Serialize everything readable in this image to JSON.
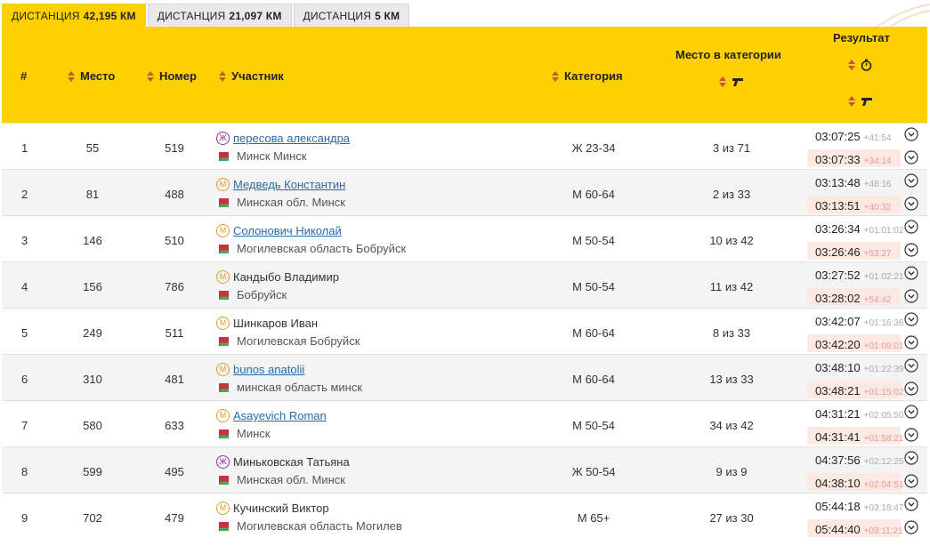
{
  "tabs": [
    {
      "prefix": "ДИСТАНЦИЯ",
      "value": "42,195 КМ",
      "active": true
    },
    {
      "prefix": "ДИСТАНЦИЯ",
      "value": "21,097 КМ",
      "active": false
    },
    {
      "prefix": "ДИСТАНЦИЯ",
      "value": "5 КМ",
      "active": false
    }
  ],
  "columns": {
    "num": "#",
    "place": "Место",
    "bib": "Номер",
    "participant": "Участник",
    "category": "Категория",
    "category_place": "Место в категории",
    "result": "Результат"
  },
  "icons": {
    "sort": "sort-arrows-icon",
    "stopwatch": "stopwatch-icon",
    "gun": "starter-pistol-icon",
    "flag": "belarus-flag-icon",
    "expand": "chevron-down-circle-icon"
  },
  "colors": {
    "header": "#ffd000",
    "sort_arrow": "#c0593d",
    "male": "#e39a2a",
    "female": "#9a2a9a",
    "link": "#2a6aa6",
    "chip": "#fbe9e2"
  },
  "rows": [
    {
      "n": "1",
      "place": "55",
      "bib": "519",
      "gender": "Ж",
      "g": "f",
      "name": "пересова александра",
      "link": true,
      "city": "Минск Минск",
      "cat": "Ж 23-34",
      "catplace": "3 из 71",
      "chip": "03:07:25",
      "chip_gap": "+41:54",
      "gun": "03:07:33",
      "gun_gap": "+34:14"
    },
    {
      "n": "2",
      "place": "81",
      "bib": "488",
      "gender": "М",
      "g": "m",
      "name": "Медведь Константин",
      "link": true,
      "city": "Минская обл. Минск",
      "cat": "М 60-64",
      "catplace": "2 из 33",
      "chip": "03:13:48",
      "chip_gap": "+48:16",
      "gun": "03:13:51",
      "gun_gap": "+40:32"
    },
    {
      "n": "3",
      "place": "146",
      "bib": "510",
      "gender": "М",
      "g": "m",
      "name": "Солонович Николай",
      "link": true,
      "city": "Могилевская область Бобруйск",
      "cat": "М 50-54",
      "catplace": "10 из 42",
      "chip": "03:26:34",
      "chip_gap": "+01:01:02",
      "gun": "03:26:46",
      "gun_gap": "+53:27"
    },
    {
      "n": "4",
      "place": "156",
      "bib": "786",
      "gender": "М",
      "g": "m",
      "name": "Кандыбо Владимир",
      "link": false,
      "city": "Бобруйск",
      "cat": "М 50-54",
      "catplace": "11 из 42",
      "chip": "03:27:52",
      "chip_gap": "+01:02:21",
      "gun": "03:28:02",
      "gun_gap": "+54:42"
    },
    {
      "n": "5",
      "place": "249",
      "bib": "511",
      "gender": "М",
      "g": "m",
      "name": "Шинкаров Иван",
      "link": false,
      "city": "Могилевская Бобруйск",
      "cat": "М 60-64",
      "catplace": "8 из 33",
      "chip": "03:42:07",
      "chip_gap": "+01:16:36",
      "gun": "03:42:20",
      "gun_gap": "+01:09:01"
    },
    {
      "n": "6",
      "place": "310",
      "bib": "481",
      "gender": "М",
      "g": "m",
      "name": "bunos anatolii",
      "link": true,
      "city": "минская область минск",
      "cat": "М 60-64",
      "catplace": "13 из 33",
      "chip": "03:48:10",
      "chip_gap": "+01:22:39",
      "gun": "03:48:21",
      "gun_gap": "+01:15:02"
    },
    {
      "n": "7",
      "place": "580",
      "bib": "633",
      "gender": "М",
      "g": "m",
      "name": "Asayevich Roman",
      "link": true,
      "city": "Минск",
      "cat": "М 50-54",
      "catplace": "34 из 42",
      "chip": "04:31:21",
      "chip_gap": "+02:05:50",
      "gun": "04:31:41",
      "gun_gap": "+01:58:21"
    },
    {
      "n": "8",
      "place": "599",
      "bib": "495",
      "gender": "Ж",
      "g": "f",
      "name": "Миньковская Татьяна",
      "link": false,
      "city": "Минская обл. Минск",
      "cat": "Ж 50-54",
      "catplace": "9 из 9",
      "chip": "04:37:56",
      "chip_gap": "+02:12:25",
      "gun": "04:38:10",
      "gun_gap": "+02:04:51"
    },
    {
      "n": "9",
      "place": "702",
      "bib": "479",
      "gender": "М",
      "g": "m",
      "name": "Кучинский Виктор",
      "link": false,
      "city": "Могилевская область Могилев",
      "cat": "М 65+",
      "catplace": "27 из 30",
      "chip": "05:44:18",
      "chip_gap": "+03:18:47",
      "gun": "05:44:40",
      "gun_gap": "+03:11:21"
    }
  ]
}
